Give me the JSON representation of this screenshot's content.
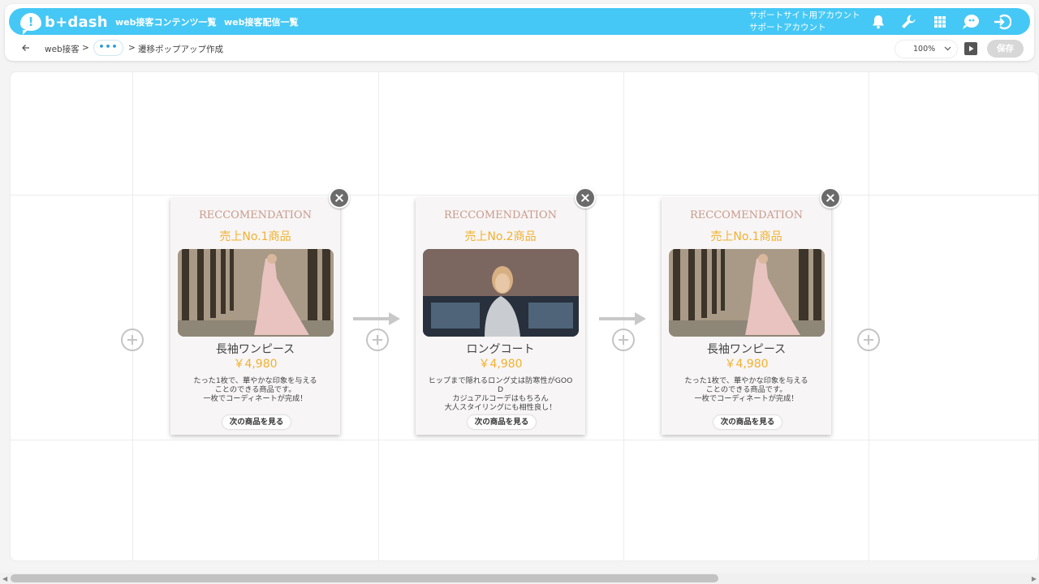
{
  "header": {
    "logo_text": "b+dash",
    "nav": [
      "web接客コンテンツ一覧",
      "web接客配信一覧"
    ],
    "account_line1": "サポートサイト用アカウント",
    "account_line2": "サポートアカウント"
  },
  "breadcrumb": {
    "root": "web接客",
    "sep1": ">",
    "more": "•••",
    "sep2": ">",
    "current": "遷移ポップアップ作成"
  },
  "toolbar": {
    "zoom_value": "100%",
    "save_label": "保存"
  },
  "popups": [
    {
      "heading": "RECCOMENDATION",
      "rank": "売上No.1商品",
      "name": "長袖ワンピース",
      "price": "￥4,980",
      "desc": [
        "たった1枚で、華やかな印象を与える",
        "ことのできる商品です。",
        "一枚でコーディネートが完成！"
      ],
      "button": "次の商品を見る"
    },
    {
      "heading": "RECCOMENDATION",
      "rank": "売上No.2商品",
      "name": "ロングコート",
      "price": "￥4,980",
      "desc": [
        "ヒップまで隠れるロング丈は防寒性がGOO",
        "D",
        "カジュアルコーデはもちろん",
        "大人スタイリングにも相性良し！"
      ],
      "button": "次の商品を見る"
    },
    {
      "heading": "RECCOMENDATION",
      "rank": "売上No.1商品",
      "name": "長袖ワンピース",
      "price": "￥4,980",
      "desc": [
        "たった1枚で、華やかな印象を与える",
        "ことのできる商品です。",
        "一枚でコーディネートが完成！"
      ],
      "button": "次の商品を見る"
    }
  ],
  "colors": {
    "brand": "#45c8f5",
    "accent_price": "#f2b130",
    "heading": "#c89a8c"
  }
}
